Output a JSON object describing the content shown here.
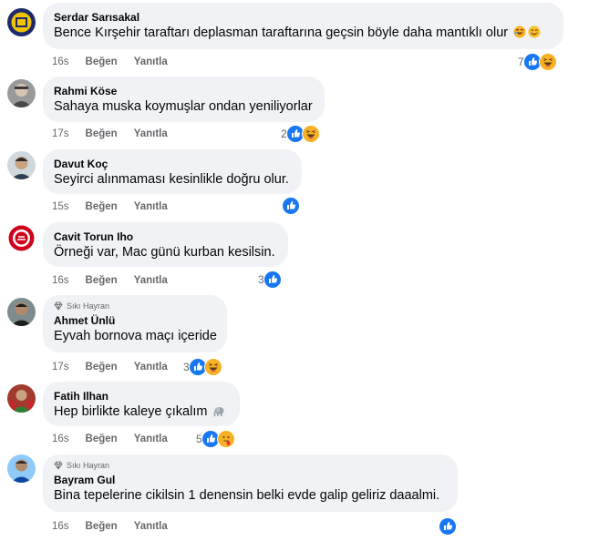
{
  "actions": {
    "like": "Beğen",
    "reply": "Yanıtla"
  },
  "colors": {
    "bubble": "#f0f2f5",
    "meta": "#65676b",
    "like_blue": "#1877f2",
    "haha_yellow": "#f7b125"
  },
  "comments": [
    {
      "author": "Serdar Sarısakal",
      "text": "Bence Kırşehir taraftarı deplasman taraftarına geçsin böyle daha mantıklı olur",
      "emojis": [
        "rolling-laughing-emoji",
        "smiling-emoji"
      ],
      "time": "16s",
      "reaction_count": "7",
      "reactions": [
        "like",
        "haha"
      ]
    },
    {
      "author": "Rahmi Köse",
      "text": "Sahaya muska koymuşlar ondan yeniliyorlar",
      "time": "17s",
      "reaction_count": "2",
      "reactions": [
        "like",
        "haha"
      ]
    },
    {
      "author": "Davut Koç",
      "text": "Seyirci alınmaması kesinlikle doğru olur.",
      "time": "15s",
      "reaction_count": "",
      "reactions": [
        "like"
      ]
    },
    {
      "author": "Cavit Torun Iho",
      "text": "Örneği var, Mac günü kurban kesilsin.",
      "time": "16s",
      "reaction_count": "3",
      "reactions": [
        "like"
      ]
    },
    {
      "badge": "Sıkı Hayran",
      "author": "Ahmet Ünlü",
      "text": "Eyvah bornova maçı içeride",
      "time": "17s",
      "reaction_count": "3",
      "reactions": [
        "like",
        "haha"
      ]
    },
    {
      "author": "Fatih Ilhan",
      "text": "Hep birlikte kaleye çıkalım",
      "emojis": [
        "elephant-emoji"
      ],
      "time": "16s",
      "reaction_count": "5",
      "reactions": [
        "like",
        "care"
      ]
    },
    {
      "badge": "Sıkı Hayran",
      "author": "Bayram Gul",
      "text": "Bina tepelerine cikilsin 1 denensin belki evde galip geliriz daaalmi.",
      "time": "16s",
      "reaction_count": "",
      "reactions": [
        "like"
      ]
    }
  ]
}
